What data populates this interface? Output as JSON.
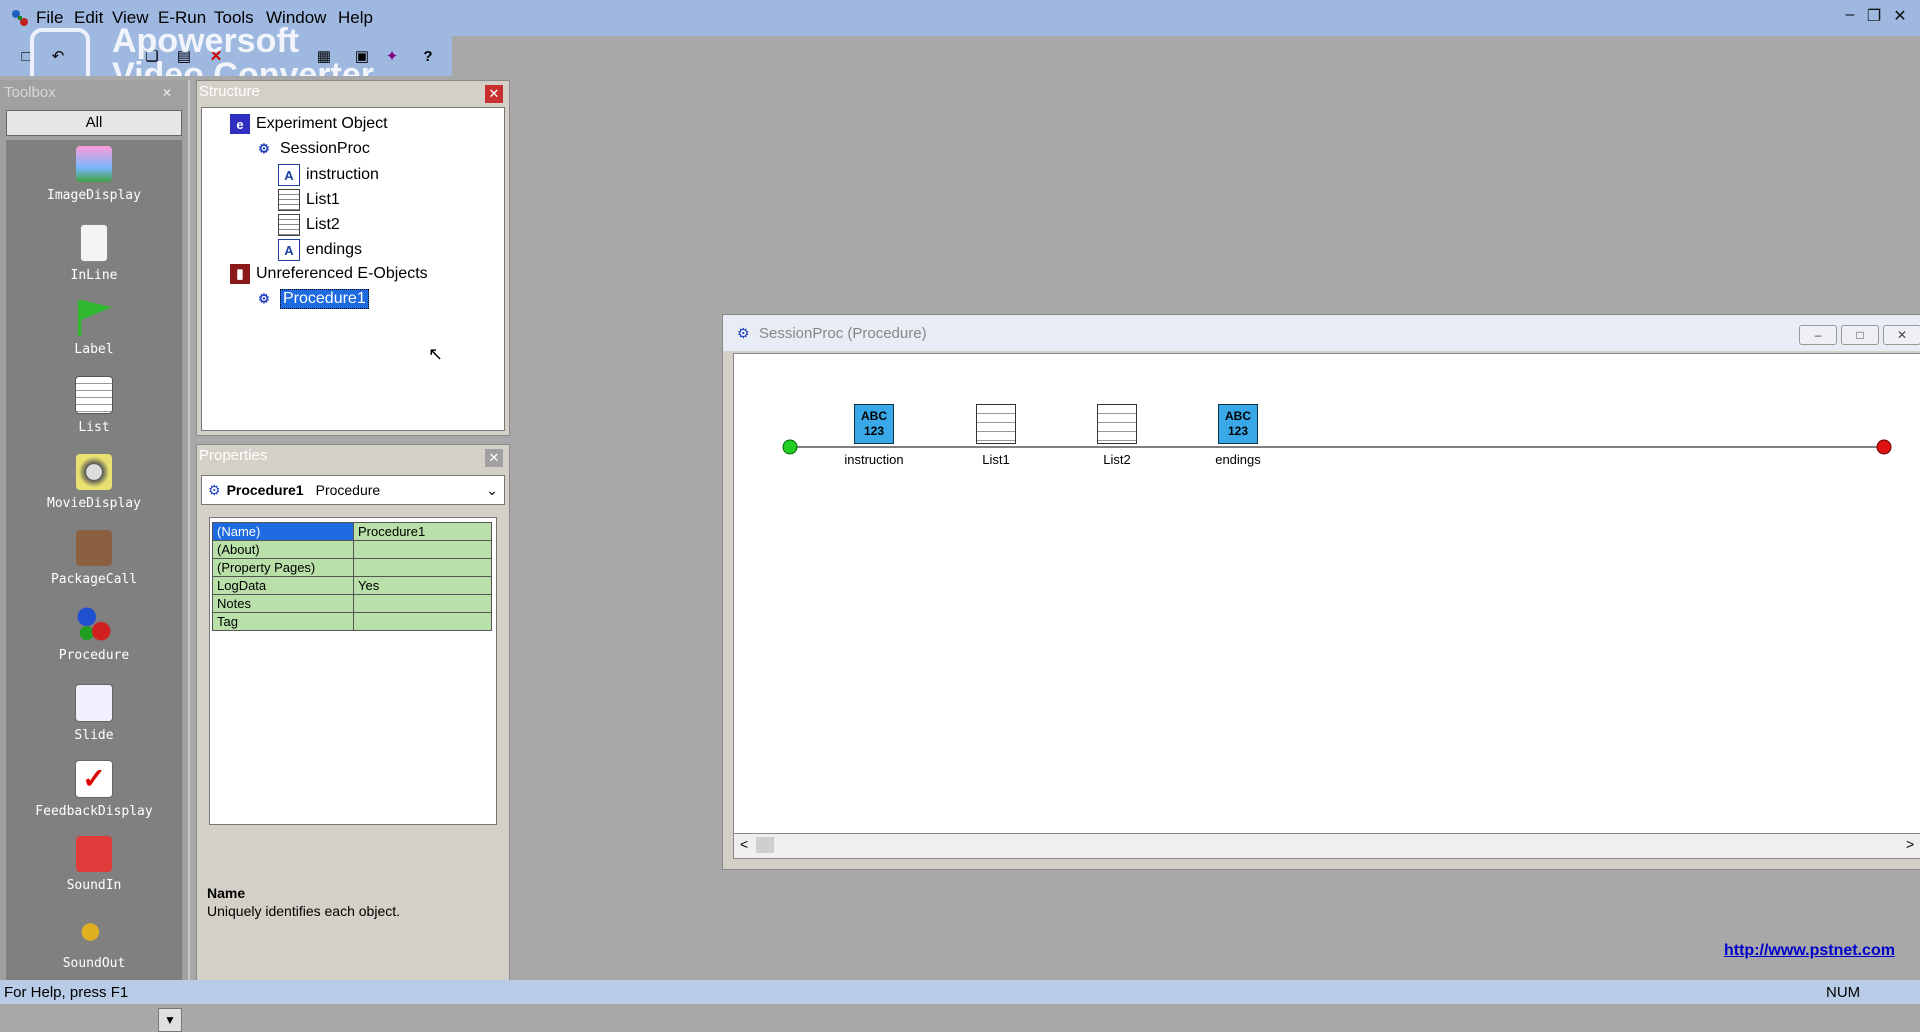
{
  "menu": [
    "File",
    "Edit",
    "View",
    "E-Run",
    "Tools",
    "Window",
    "Help"
  ],
  "watermark": {
    "line1": "Apowersoft",
    "line2": "Video Converter"
  },
  "toolbox": {
    "title": "Toolbox",
    "filter": "All",
    "items": [
      "ImageDisplay",
      "InLine",
      "Label",
      "List",
      "MovieDisplay",
      "PackageCall",
      "Procedure",
      "Slide",
      "FeedbackDisplay",
      "SoundIn",
      "SoundOut"
    ]
  },
  "structure": {
    "title": "Structure",
    "nodes": {
      "root": "Experiment Object",
      "session": "SessionProc",
      "instruction": "instruction",
      "list1": "List1",
      "list2": "List2",
      "endings": "endings",
      "unref": "Unreferenced E-Objects",
      "procedure1": "Procedure1"
    }
  },
  "properties": {
    "title": "Properties",
    "object_name": "Procedure1",
    "object_type": "Procedure",
    "rows": [
      {
        "key": "(Name)",
        "value": "Procedure1"
      },
      {
        "key": "(About)",
        "value": ""
      },
      {
        "key": "(Property Pages)",
        "value": ""
      },
      {
        "key": "LogData",
        "value": "Yes"
      },
      {
        "key": "Notes",
        "value": ""
      },
      {
        "key": "Tag",
        "value": ""
      }
    ],
    "desc_title": "Name",
    "desc_text": "Uniquely identifies each object."
  },
  "session_window": {
    "title": "SessionProc  (Procedure)",
    "icon_badge": "ABC 123",
    "nodes": [
      "instruction",
      "List1",
      "List2",
      "endings"
    ]
  },
  "link": "http://www.pstnet.com",
  "status": {
    "help": "For Help, press F1",
    "num": "NUM"
  },
  "colors": {
    "accent": "#1e6ae0",
    "start": "#22cc22",
    "end": "#dd1111",
    "grid": "#b8e0a8"
  }
}
